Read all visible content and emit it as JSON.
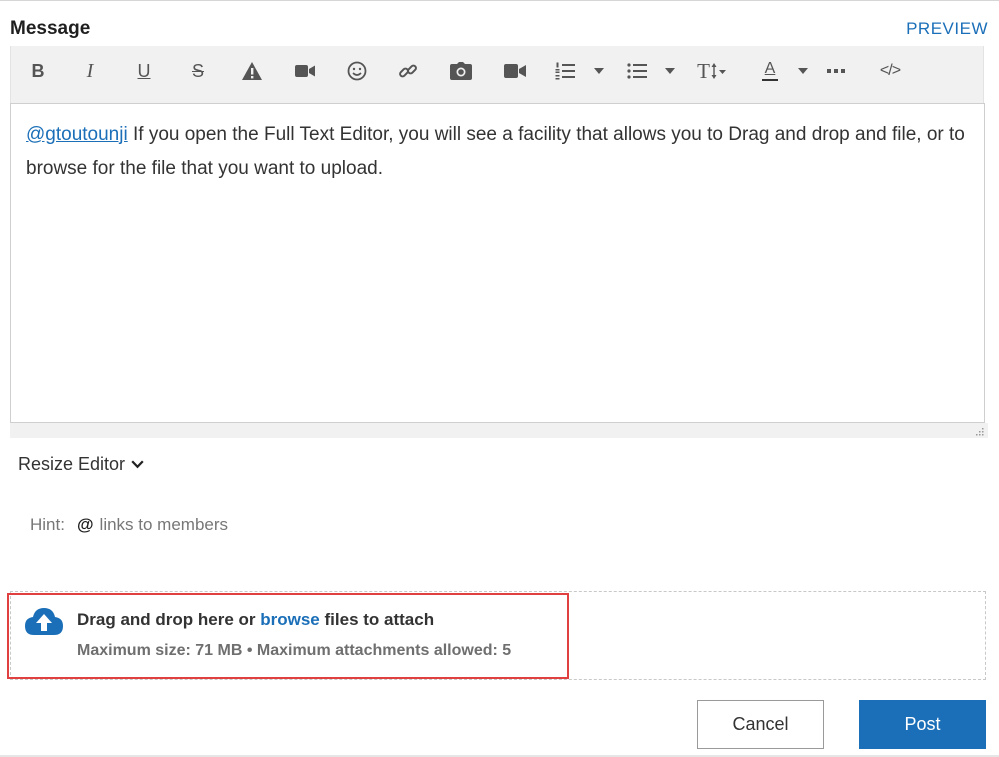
{
  "header": {
    "title": "Message",
    "preview_label": "PREVIEW"
  },
  "toolbar": {
    "items": [
      {
        "name": "bold",
        "glyph": "B"
      },
      {
        "name": "italic",
        "glyph": "I"
      },
      {
        "name": "underline",
        "glyph": "U"
      },
      {
        "name": "strikethrough",
        "glyph": "S"
      },
      {
        "name": "spoiler",
        "icon": "warning-icon"
      },
      {
        "name": "video",
        "icon": "video-camera-icon"
      },
      {
        "name": "emoji",
        "icon": "smiley-icon"
      },
      {
        "name": "link",
        "icon": "link-icon"
      },
      {
        "name": "photo",
        "icon": "camera-icon"
      },
      {
        "name": "video-upload",
        "icon": "video-camera-icon"
      },
      {
        "name": "numbered-list",
        "icon": "numbered-list-icon"
      },
      {
        "name": "bullet-list",
        "icon": "bullet-list-icon"
      },
      {
        "name": "font-size",
        "glyph": "T"
      },
      {
        "name": "font-color",
        "glyph": "A"
      },
      {
        "name": "more",
        "icon": "more-icon"
      },
      {
        "name": "source",
        "glyph": "</>"
      }
    ]
  },
  "editor": {
    "mention": "@gtoutounji",
    "body": " If you open the Full Text Editor, you will see a facility that allows you to Drag and drop and file, or to browse for the file that you want to upload."
  },
  "resize": {
    "label": "Resize Editor"
  },
  "hint": {
    "label": "Hint:",
    "symbol": "@",
    "text": "links to members"
  },
  "attachments": {
    "prefix": "Drag and drop here or ",
    "browse_label": "browse",
    "suffix": " files to attach",
    "limits": "Maximum size: 71 MB • Maximum attachments allowed: 5"
  },
  "actions": {
    "cancel_label": "Cancel",
    "post_label": "Post"
  },
  "colors": {
    "accent": "#1b6fb8",
    "highlight": "#e0403f",
    "toolbar_bg": "#f1f1f1"
  }
}
